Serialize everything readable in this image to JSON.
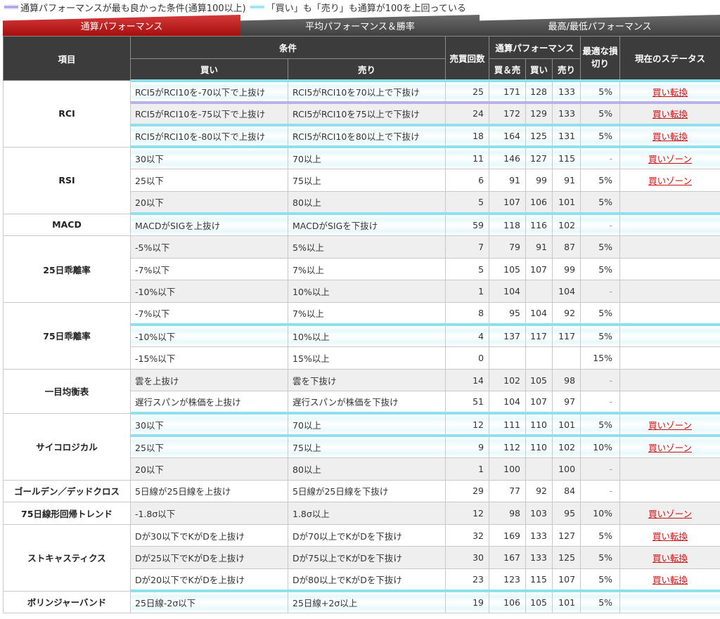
{
  "legend": {
    "purple_text": "通算パフォーマンスが最も良かった条件(通算100以上)",
    "cyan_text": "「買い」も「売り」も通算が100を上回っている"
  },
  "tabs": [
    "通算パフォーマンス",
    "平均パフォーマンス＆勝率",
    "最高/最低パフォーマンス"
  ],
  "headers": {
    "item": "項目",
    "condition": "条件",
    "buy": "買い",
    "sell": "売り",
    "trades": "売買回数",
    "total_perf": "通算パフォーマンス",
    "both": "買＆売",
    "perf_buy": "買い",
    "perf_sell": "売り",
    "stoploss": "最適な損切り",
    "status": "現在のステータス"
  },
  "groups": [
    {
      "name": "RCI",
      "rows": [
        {
          "buy": "RCI5がRCI10を-70以下で上抜け",
          "sell": "RCI5がRCI10を70以上で下抜け",
          "trades": "25",
          "both": "171",
          "pbuy": "128",
          "psell": "133",
          "sl": "5%",
          "status": "買い転換"
        },
        {
          "buy": "RCI5がRCI10を-75以下で上抜け",
          "sell": "RCI5がRCI10を75以上で下抜け",
          "trades": "24",
          "both": "172",
          "pbuy": "129",
          "psell": "133",
          "sl": "5%",
          "status": "買い転換"
        },
        {
          "buy": "RCI5がRCI10を-80以下で上抜け",
          "sell": "RCI5がRCI10を80以上で下抜け",
          "trades": "18",
          "both": "164",
          "pbuy": "125",
          "psell": "131",
          "sl": "5%",
          "status": "買い転換"
        }
      ]
    },
    {
      "name": "RSI",
      "rows": [
        {
          "buy": "30以下",
          "sell": "70以上",
          "trades": "11",
          "both": "146",
          "pbuy": "127",
          "psell": "115",
          "sl": "-",
          "status": "買いゾーン"
        },
        {
          "buy": "25以下",
          "sell": "75以上",
          "trades": "6",
          "both": "91",
          "pbuy": "99",
          "psell": "91",
          "sl": "5%",
          "status": "買いゾーン"
        },
        {
          "buy": "20以下",
          "sell": "80以上",
          "trades": "5",
          "both": "107",
          "pbuy": "106",
          "psell": "101",
          "sl": "5%",
          "status": ""
        }
      ]
    },
    {
      "name": "MACD",
      "rows": [
        {
          "buy": "MACDがSIGを上抜け",
          "sell": "MACDがSIGを下抜け",
          "trades": "59",
          "both": "118",
          "pbuy": "116",
          "psell": "102",
          "sl": "-",
          "status": ""
        }
      ]
    },
    {
      "name": "25日乖離率",
      "rows": [
        {
          "buy": "-5%以下",
          "sell": "5%以上",
          "trades": "7",
          "both": "79",
          "pbuy": "91",
          "psell": "87",
          "sl": "5%",
          "status": ""
        },
        {
          "buy": "-7%以下",
          "sell": "7%以上",
          "trades": "5",
          "both": "105",
          "pbuy": "107",
          "psell": "99",
          "sl": "5%",
          "status": ""
        },
        {
          "buy": "-10%以下",
          "sell": "10%以上",
          "trades": "1",
          "both": "104",
          "pbuy": "",
          "psell": "104",
          "sl": "-",
          "status": ""
        }
      ]
    },
    {
      "name": "75日乖離率",
      "rows": [
        {
          "buy": "-7%以下",
          "sell": "7%以上",
          "trades": "8",
          "both": "95",
          "pbuy": "104",
          "psell": "92",
          "sl": "5%",
          "status": ""
        },
        {
          "buy": "-10%以下",
          "sell": "10%以上",
          "trades": "4",
          "both": "137",
          "pbuy": "117",
          "psell": "117",
          "sl": "5%",
          "status": ""
        },
        {
          "buy": "-15%以下",
          "sell": "15%以上",
          "trades": "0",
          "both": "",
          "pbuy": "",
          "psell": "",
          "sl": "15%",
          "status": ""
        }
      ]
    },
    {
      "name": "一目均衡表",
      "rows": [
        {
          "buy": "雲を上抜け",
          "sell": "雲を下抜け",
          "trades": "14",
          "both": "102",
          "pbuy": "105",
          "psell": "98",
          "sl": "-",
          "status": ""
        },
        {
          "buy": "遅行スパンが株価を上抜け",
          "sell": "遅行スパンが株価を下抜け",
          "trades": "51",
          "both": "104",
          "pbuy": "107",
          "psell": "97",
          "sl": "-",
          "status": ""
        }
      ]
    },
    {
      "name": "サイコロジカル",
      "rows": [
        {
          "buy": "30以下",
          "sell": "70以上",
          "trades": "12",
          "both": "111",
          "pbuy": "110",
          "psell": "101",
          "sl": "5%",
          "status": "買いゾーン"
        },
        {
          "buy": "25以下",
          "sell": "75以上",
          "trades": "9",
          "both": "112",
          "pbuy": "110",
          "psell": "102",
          "sl": "10%",
          "status": "買いゾーン"
        },
        {
          "buy": "20以下",
          "sell": "80以上",
          "trades": "1",
          "both": "100",
          "pbuy": "",
          "psell": "100",
          "sl": "-",
          "status": ""
        }
      ]
    },
    {
      "name": "ゴールデン／デッドクロス",
      "rows": [
        {
          "buy": "5日線が25日線を上抜け",
          "sell": "5日線が25日線を下抜け",
          "trades": "29",
          "both": "77",
          "pbuy": "92",
          "psell": "84",
          "sl": "-",
          "status": ""
        }
      ]
    },
    {
      "name": "75日線形回帰トレンド",
      "rows": [
        {
          "buy": "-1.8σ以下",
          "sell": "1.8σ以上",
          "trades": "12",
          "both": "98",
          "pbuy": "103",
          "psell": "95",
          "sl": "10%",
          "status": "買いゾーン"
        }
      ]
    },
    {
      "name": "ストキャスティクス",
      "rows": [
        {
          "buy": "Dが30以下でKがDを上抜け",
          "sell": "Dが70以上でKがDを下抜け",
          "trades": "32",
          "both": "169",
          "pbuy": "133",
          "psell": "127",
          "sl": "5%",
          "status": "買い転換"
        },
        {
          "buy": "Dが25以下でKがDを上抜け",
          "sell": "Dが75以上でKがDを下抜け",
          "trades": "30",
          "both": "167",
          "pbuy": "133",
          "psell": "125",
          "sl": "5%",
          "status": "買い転換"
        },
        {
          "buy": "Dが20以下でKがDを上抜け",
          "sell": "Dが80以上でKがDを下抜け",
          "trades": "23",
          "both": "123",
          "pbuy": "115",
          "psell": "107",
          "sl": "5%",
          "status": "買い転換"
        }
      ]
    },
    {
      "name": "ボリンジャーバンド",
      "rows": [
        {
          "buy": "25日線-2σ以下",
          "sell": "25日線+2σ以上",
          "trades": "19",
          "both": "106",
          "pbuy": "105",
          "psell": "101",
          "sl": "5%",
          "status": ""
        }
      ]
    }
  ],
  "highlights": {
    "purple": [
      "0.1"
    ],
    "cyan": [
      "0.0",
      "0.1",
      "0.2",
      "1.0",
      "2.0",
      "4.1",
      "6.0",
      "6.1",
      "10.0",
      "10.1",
      "10.2"
    ],
    "mix": []
  },
  "colors": {
    "tab_active": "#b51a1a",
    "tab_inactive": "#505050",
    "header_bg": "#3c3c3c",
    "status_link": "#cc1111",
    "highlight_purple": "#b9b1ec",
    "highlight_cyan": "#8fe0ee"
  }
}
